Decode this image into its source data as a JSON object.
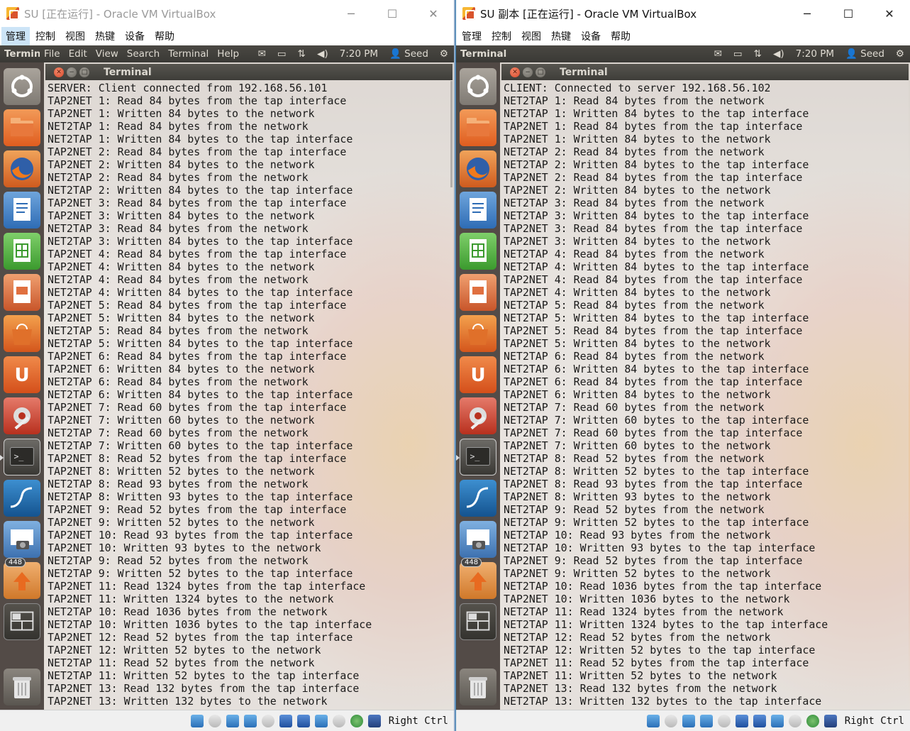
{
  "left": {
    "window_title": "SU [正在运行] - Oracle VM VirtualBox",
    "menus": [
      "管理",
      "控制",
      "视图",
      "热键",
      "设备",
      "帮助"
    ],
    "panel": {
      "app_name": "Terminal",
      "menus": [
        "File",
        "Edit",
        "View",
        "Search",
        "Terminal",
        "Help"
      ],
      "time": "7:20 PM",
      "user": "Seed"
    },
    "terminal_title": "Terminal",
    "lines": [
      "SERVER: Client connected from 192.168.56.101",
      "TAP2NET 1: Read 84 bytes from the tap interface",
      "TAP2NET 1: Written 84 bytes to the network",
      "NET2TAP 1: Read 84 bytes from the network",
      "NET2TAP 1: Written 84 bytes to the tap interface",
      "TAP2NET 2: Read 84 bytes from the tap interface",
      "TAP2NET 2: Written 84 bytes to the network",
      "NET2TAP 2: Read 84 bytes from the network",
      "NET2TAP 2: Written 84 bytes to the tap interface",
      "TAP2NET 3: Read 84 bytes from the tap interface",
      "TAP2NET 3: Written 84 bytes to the network",
      "NET2TAP 3: Read 84 bytes from the network",
      "NET2TAP 3: Written 84 bytes to the tap interface",
      "TAP2NET 4: Read 84 bytes from the tap interface",
      "TAP2NET 4: Written 84 bytes to the network",
      "NET2TAP 4: Read 84 bytes from the network",
      "NET2TAP 4: Written 84 bytes to the tap interface",
      "TAP2NET 5: Read 84 bytes from the tap interface",
      "TAP2NET 5: Written 84 bytes to the network",
      "NET2TAP 5: Read 84 bytes from the network",
      "NET2TAP 5: Written 84 bytes to the tap interface",
      "TAP2NET 6: Read 84 bytes from the tap interface",
      "TAP2NET 6: Written 84 bytes to the network",
      "NET2TAP 6: Read 84 bytes from the network",
      "NET2TAP 6: Written 84 bytes to the tap interface",
      "TAP2NET 7: Read 60 bytes from the tap interface",
      "TAP2NET 7: Written 60 bytes to the network",
      "NET2TAP 7: Read 60 bytes from the network",
      "NET2TAP 7: Written 60 bytes to the tap interface",
      "TAP2NET 8: Read 52 bytes from the tap interface",
      "TAP2NET 8: Written 52 bytes to the network",
      "NET2TAP 8: Read 93 bytes from the network",
      "NET2TAP 8: Written 93 bytes to the tap interface",
      "TAP2NET 9: Read 52 bytes from the tap interface",
      "TAP2NET 9: Written 52 bytes to the network",
      "TAP2NET 10: Read 93 bytes from the tap interface",
      "TAP2NET 10: Written 93 bytes to the network",
      "NET2TAP 9: Read 52 bytes from the network",
      "NET2TAP 9: Written 52 bytes to the tap interface",
      "TAP2NET 11: Read 1324 bytes from the tap interface",
      "TAP2NET 11: Written 1324 bytes to the network",
      "NET2TAP 10: Read 1036 bytes from the network",
      "NET2TAP 10: Written 1036 bytes to the tap interface",
      "TAP2NET 12: Read 52 bytes from the tap interface",
      "TAP2NET 12: Written 52 bytes to the network",
      "NET2TAP 11: Read 52 bytes from the network",
      "NET2TAP 11: Written 52 bytes to the tap interface",
      "TAP2NET 13: Read 132 bytes from the tap interface",
      "TAP2NET 13: Written 132 bytes to the network"
    ],
    "host_key": "Right Ctrl"
  },
  "right": {
    "window_title": "SU 副本 [正在运行] - Oracle VM VirtualBox",
    "menus": [
      "管理",
      "控制",
      "视图",
      "热键",
      "设备",
      "帮助"
    ],
    "panel": {
      "app_name": "Terminal",
      "time": "7:20 PM",
      "user": "Seed"
    },
    "terminal_title": "Terminal",
    "lines": [
      "CLIENT: Connected to server 192.168.56.102",
      "NET2TAP 1: Read 84 bytes from the network",
      "NET2TAP 1: Written 84 bytes to the tap interface",
      "TAP2NET 1: Read 84 bytes from the tap interface",
      "TAP2NET 1: Written 84 bytes to the network",
      "NET2TAP 2: Read 84 bytes from the network",
      "NET2TAP 2: Written 84 bytes to the tap interface",
      "TAP2NET 2: Read 84 bytes from the tap interface",
      "TAP2NET 2: Written 84 bytes to the network",
      "NET2TAP 3: Read 84 bytes from the network",
      "NET2TAP 3: Written 84 bytes to the tap interface",
      "TAP2NET 3: Read 84 bytes from the tap interface",
      "TAP2NET 3: Written 84 bytes to the network",
      "NET2TAP 4: Read 84 bytes from the network",
      "NET2TAP 4: Written 84 bytes to the tap interface",
      "TAP2NET 4: Read 84 bytes from the tap interface",
      "TAP2NET 4: Written 84 bytes to the network",
      "NET2TAP 5: Read 84 bytes from the network",
      "NET2TAP 5: Written 84 bytes to the tap interface",
      "TAP2NET 5: Read 84 bytes from the tap interface",
      "TAP2NET 5: Written 84 bytes to the network",
      "NET2TAP 6: Read 84 bytes from the network",
      "NET2TAP 6: Written 84 bytes to the tap interface",
      "TAP2NET 6: Read 84 bytes from the tap interface",
      "TAP2NET 6: Written 84 bytes to the network",
      "NET2TAP 7: Read 60 bytes from the network",
      "NET2TAP 7: Written 60 bytes to the tap interface",
      "TAP2NET 7: Read 60 bytes from the tap interface",
      "TAP2NET 7: Written 60 bytes to the network",
      "NET2TAP 8: Read 52 bytes from the network",
      "NET2TAP 8: Written 52 bytes to the tap interface",
      "TAP2NET 8: Read 93 bytes from the tap interface",
      "TAP2NET 8: Written 93 bytes to the network",
      "NET2TAP 9: Read 52 bytes from the network",
      "NET2TAP 9: Written 52 bytes to the tap interface",
      "NET2TAP 10: Read 93 bytes from the network",
      "NET2TAP 10: Written 93 bytes to the tap interface",
      "TAP2NET 9: Read 52 bytes from the tap interface",
      "TAP2NET 9: Written 52 bytes to the network",
      "NET2TAP 10: Read 1036 bytes from the tap interface",
      "TAP2NET 10: Written 1036 bytes to the network",
      "NET2TAP 11: Read 1324 bytes from the network",
      "NET2TAP 11: Written 1324 bytes to the tap interface",
      "NET2TAP 12: Read 52 bytes from the network",
      "NET2TAP 12: Written 52 bytes to the tap interface",
      "TAP2NET 11: Read 52 bytes from the tap interface",
      "TAP2NET 11: Written 52 bytes to the network",
      "TAP2NET 13: Read 132 bytes from the network",
      "NET2TAP 13: Written 132 bytes to the tap interface"
    ],
    "host_key": "Right Ctrl"
  },
  "launcher": {
    "workspace_badge": "448",
    "icons": [
      "ubuntu-dash-icon",
      "files-icon",
      "firefox-icon",
      "writer-icon",
      "calc-icon",
      "impress-icon",
      "software-center-icon",
      "ubuntu-one-icon",
      "system-settings-icon",
      "terminal-icon",
      "wireshark-icon",
      "screenshot-icon",
      "update-manager-icon",
      "workspace-switcher-icon",
      "trash-icon"
    ]
  },
  "window_controls": {
    "minimize": "─",
    "maximize": "☐",
    "close": "✕"
  },
  "colors": {
    "panel": "#3c3b37",
    "launcher": "#3a322e",
    "term_text": "#1a1a1a",
    "close_button": "#e05a3a"
  }
}
